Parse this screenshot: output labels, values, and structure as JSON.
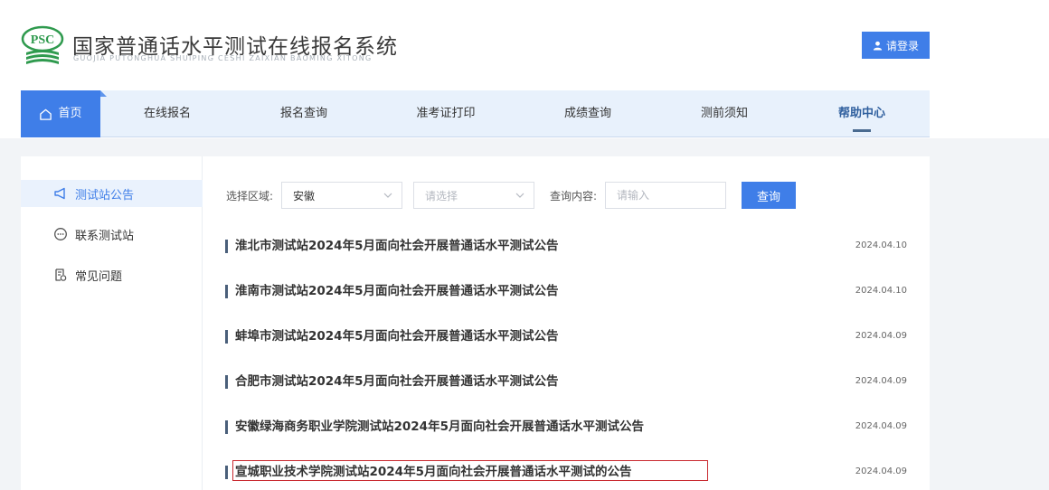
{
  "header": {
    "logo_text": "PSC",
    "title": "国家普通话水平测试在线报名系统",
    "subtitle": "GUOJIA PUTONGHUA SHUIPING CESHI ZAIXIAN BAOMING XITONG",
    "login_label": "请登录"
  },
  "nav": {
    "items": [
      {
        "label": "首页"
      },
      {
        "label": "在线报名"
      },
      {
        "label": "报名查询"
      },
      {
        "label": "准考证打印"
      },
      {
        "label": "成绩查询"
      },
      {
        "label": "测前须知"
      },
      {
        "label": "帮助中心"
      }
    ]
  },
  "sidebar": {
    "items": [
      {
        "label": "测试站公告",
        "icon": "megaphone-icon"
      },
      {
        "label": "联系测试站",
        "icon": "chat-icon"
      },
      {
        "label": "常见问题",
        "icon": "faq-document-icon"
      }
    ]
  },
  "filters": {
    "region_label": "选择区域:",
    "province_value": "安徽",
    "city_placeholder": "请选择",
    "query_label": "查询内容:",
    "query_placeholder": "请输入",
    "query_button": "查询"
  },
  "announcements": [
    {
      "title": "淮北市测试站2024年5月面向社会开展普通话水平测试公告",
      "date": "2024.04.10"
    },
    {
      "title": "淮南市测试站2024年5月面向社会开展普通话水平测试公告",
      "date": "2024.04.10"
    },
    {
      "title": "蚌埠市测试站2024年5月面向社会开展普通话水平测试公告",
      "date": "2024.04.09"
    },
    {
      "title": "合肥市测试站2024年5月面向社会开展普通话水平测试公告",
      "date": "2024.04.09"
    },
    {
      "title": "安徽绿海商务职业学院测试站2024年5月面向社会开展普通话水平测试公告",
      "date": "2024.04.09"
    },
    {
      "title": "宣城职业技术学院测试站2024年5月面向社会开展普通话水平测试的公告",
      "date": "2024.04.09"
    }
  ],
  "colors": {
    "accent": "#3f7ee8",
    "nav_bg": "#e8f1fc",
    "logo_green": "#2f9a4e",
    "highlight": "#c9292f"
  }
}
